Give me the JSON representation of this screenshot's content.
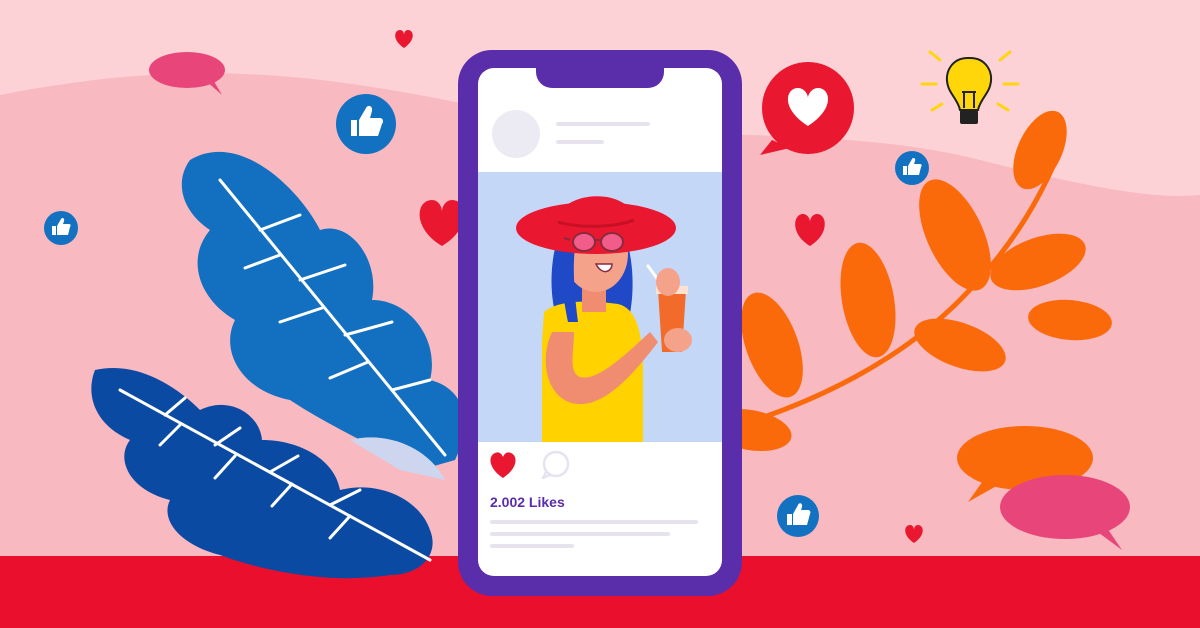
{
  "post": {
    "likes_text": "2.002 Likes"
  },
  "icons": {
    "like": "heart-icon",
    "comment": "comment-bubble-icon",
    "thumbs": "thumbs-up-icon",
    "idea": "lightbulb-icon"
  },
  "colors": {
    "background": "#fcd2d6",
    "hill": "#f8b9c0",
    "floor": "#ea0f2d",
    "phone": "#5a2daa",
    "heart": "#e9172f",
    "thumb_badge": "#1271c0",
    "leaf_blue": "#136fbf",
    "leaf_navy": "#0b4aa2",
    "leaf_orange": "#fb6a0a",
    "bubble_pink": "#e8457a"
  }
}
